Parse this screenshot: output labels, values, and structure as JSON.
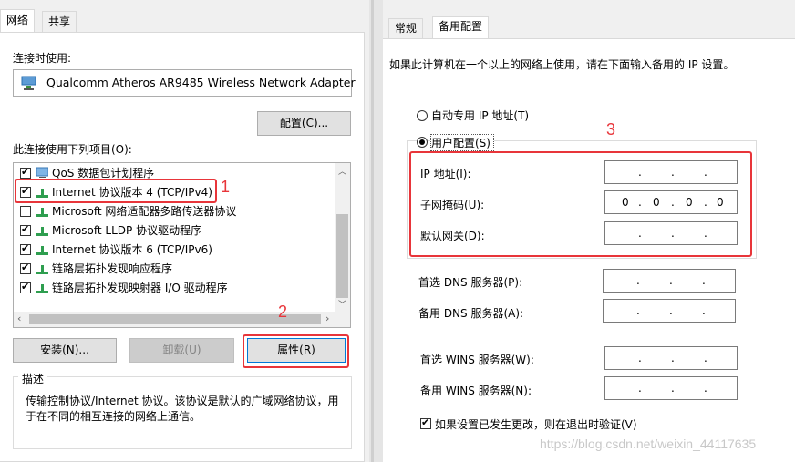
{
  "left": {
    "tabs": [
      {
        "label": "网络"
      },
      {
        "label": "共享"
      }
    ],
    "connect_using_label": "连接时使用:",
    "adapter_name": "Qualcomm Atheros AR9485 Wireless Network Adapter",
    "configure_button": "配置(C)...",
    "items_label": "此连接使用下列项目(O):",
    "items": [
      {
        "label": "QoS 数据包计划程序",
        "checked": true
      },
      {
        "label": "Internet 协议版本 4 (TCP/IPv4)",
        "checked": true
      },
      {
        "label": "Microsoft 网络适配器多路传送器协议",
        "checked": false
      },
      {
        "label": "Microsoft LLDP 协议驱动程序",
        "checked": true
      },
      {
        "label": "Internet 协议版本 6 (TCP/IPv6)",
        "checked": true
      },
      {
        "label": "链路层拓扑发现响应程序",
        "checked": true
      },
      {
        "label": "链路层拓扑发现映射器 I/O 驱动程序",
        "checked": true
      }
    ],
    "install_button": "安装(N)...",
    "uninstall_button": "卸载(U)",
    "properties_button": "属性(R)",
    "description_title": "描述",
    "description_line1": "传输控制协议/Internet 协议。该协议是默认的广域网络协议，用",
    "description_line2": "于在不同的相互连接的网络上通信。"
  },
  "right": {
    "tabs": [
      {
        "label": "常规"
      },
      {
        "label": "备用配置"
      }
    ],
    "intro": "如果此计算机在一个以上的网络上使用，请在下面输入备用的 IP 设置。",
    "auto_private_label": "自动专用 IP 地址(T)",
    "user_config_label": "用户配置(S)",
    "ip_label": "IP 地址(I):",
    "subnet_label": "子网掩码(U):",
    "gateway_label": "默认网关(D):",
    "pref_dns_label": "首选 DNS 服务器(P):",
    "alt_dns_label": "备用 DNS 服务器(A):",
    "pref_wins_label": "首选 WINS 服务器(W):",
    "alt_wins_label": "备用 WINS 服务器(N):",
    "subnet_octets": [
      "0",
      "0",
      "0",
      "0"
    ],
    "validate_label": "如果设置已发生更改，则在退出时验证(V)",
    "validate_checked": true
  },
  "annotations": {
    "one": "1",
    "two": "2",
    "three": "3"
  },
  "watermark": "https://blog.csdn.net/weixin_44117635",
  "colors": {
    "annotation_red": "#e8353a"
  }
}
